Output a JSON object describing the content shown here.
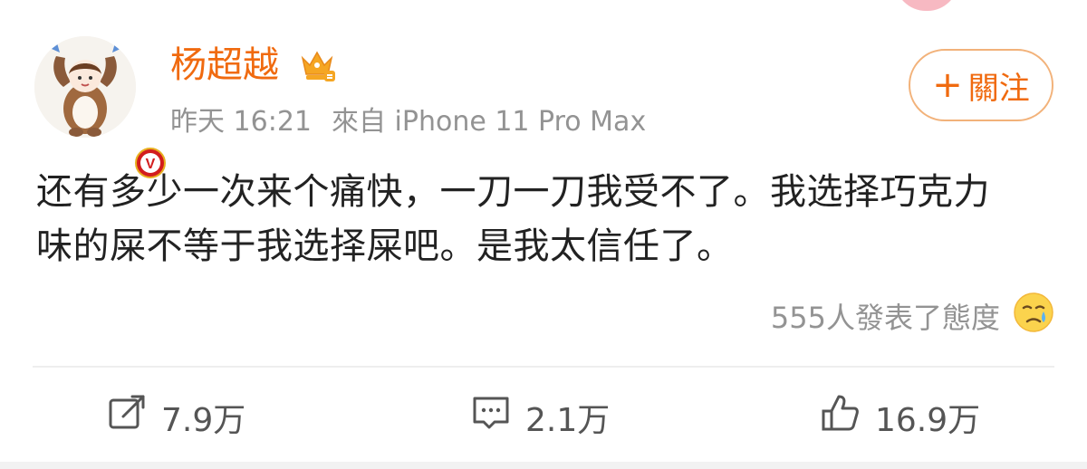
{
  "post": {
    "author": {
      "name": "杨超越",
      "avatar_icon": "avatar-image",
      "badge_icon": "verified-v-badge-icon",
      "crown_icon": "member-crown-icon",
      "badge_letter": "V"
    },
    "meta": {
      "time": "昨天 16:21",
      "source": "來自 iPhone 11 Pro Max"
    },
    "follow_button": {
      "plus": "+",
      "label": "關注"
    },
    "text_line1": "还有多少一次来个痛快，一刀一刀我受不了。我选择巧克力",
    "text_line2": "味的屎不等于我选择屎吧。是我太信任了。",
    "reaction": {
      "summary": "555人發表了態度",
      "emoji_icon": "sad-emoji-icon"
    },
    "actions": {
      "repost": "7.9万",
      "comment": "2.1万",
      "like": "16.9万"
    }
  },
  "colors": {
    "accent": "#f06a0f",
    "meta_text": "#939393",
    "body_text": "#222222",
    "follow_border": "#f2b27a",
    "badge": "#e8b020"
  }
}
